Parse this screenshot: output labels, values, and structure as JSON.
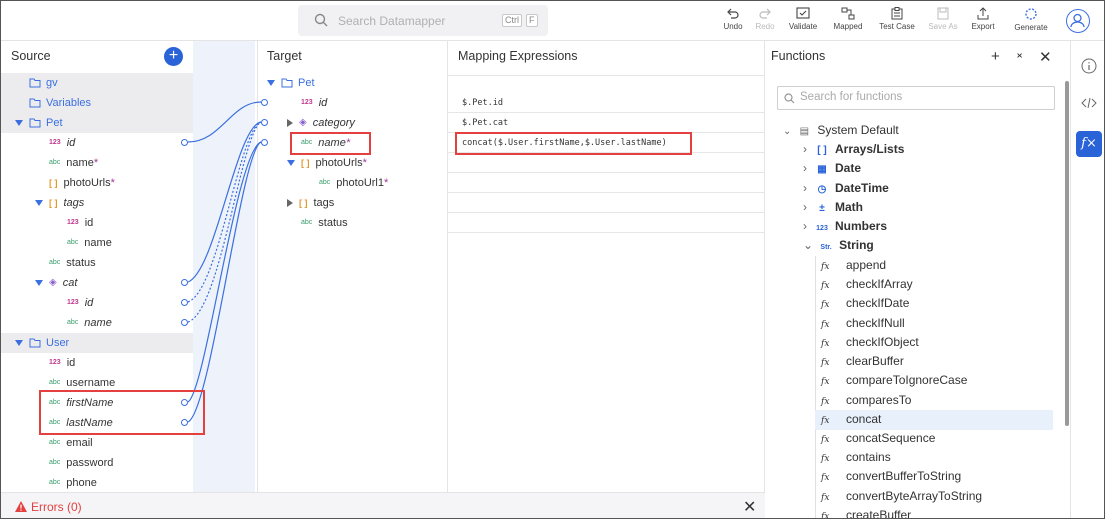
{
  "toolbar": {
    "search_placeholder": "Search Datamapper",
    "shortcut_key1": "Ctrl",
    "shortcut_key2": "F",
    "buttons": [
      {
        "label": "Undo",
        "enabled": true
      },
      {
        "label": "Redo",
        "enabled": false
      },
      {
        "label": "Validate",
        "enabled": true
      },
      {
        "label": "Mapped",
        "enabled": true
      },
      {
        "label": "Test Case",
        "enabled": true
      },
      {
        "label": "Save As",
        "enabled": false
      },
      {
        "label": "Export",
        "enabled": true
      },
      {
        "label": "Generate",
        "enabled": true
      }
    ]
  },
  "source": {
    "title": "Source",
    "items": [
      {
        "label": "gv",
        "type": "collection",
        "indent": 0
      },
      {
        "label": "Variables",
        "type": "collection",
        "indent": 0
      },
      {
        "label": "Pet",
        "type": "collection-open",
        "indent": 0
      },
      {
        "label": "id",
        "type": "number",
        "italic": true,
        "indent": 1
      },
      {
        "label": "name",
        "type": "string",
        "required": "*",
        "indent": 1
      },
      {
        "label": "photoUrls",
        "type": "array",
        "required": "*",
        "indent": 1
      },
      {
        "label": "tags",
        "type": "array-open",
        "italic": true,
        "indent": 1
      },
      {
        "label": "id",
        "type": "number",
        "indent": 2
      },
      {
        "label": "name",
        "type": "string",
        "indent": 2
      },
      {
        "label": "status",
        "type": "string",
        "indent": 1
      },
      {
        "label": "cat",
        "type": "object-open",
        "italic": true,
        "indent": 1
      },
      {
        "label": "id",
        "type": "number",
        "italic": true,
        "indent": 2
      },
      {
        "label": "name",
        "type": "string",
        "italic": true,
        "indent": 2
      },
      {
        "label": "User",
        "type": "collection-open",
        "indent": 0
      },
      {
        "label": "id",
        "type": "number",
        "indent": 1
      },
      {
        "label": "username",
        "type": "string",
        "indent": 1
      },
      {
        "label": "firstName",
        "type": "string",
        "italic": true,
        "indent": 1
      },
      {
        "label": "lastName",
        "type": "string",
        "italic": true,
        "indent": 1
      },
      {
        "label": "email",
        "type": "string",
        "indent": 1
      },
      {
        "label": "password",
        "type": "string",
        "indent": 1
      },
      {
        "label": "phone",
        "type": "string",
        "indent": 1
      }
    ]
  },
  "target": {
    "title": "Target",
    "items": [
      {
        "label": "Pet",
        "type": "collection-open",
        "indent": 0
      },
      {
        "label": "id",
        "type": "number",
        "italic": true,
        "indent": 1
      },
      {
        "label": "category",
        "type": "object-closed",
        "italic": true,
        "indent": 1
      },
      {
        "label": "name",
        "type": "string",
        "italic": true,
        "required": "*",
        "indent": 1
      },
      {
        "label": "photoUrls",
        "type": "array-open",
        "required": "*",
        "indent": 1
      },
      {
        "label": "photoUrl1",
        "type": "string",
        "required": "*",
        "indent": 2
      },
      {
        "label": "tags",
        "type": "array-closed",
        "indent": 1
      },
      {
        "label": "status",
        "type": "string",
        "indent": 1
      }
    ]
  },
  "mapping": {
    "title": "Mapping Expressions",
    "expressions": [
      "$.Pet.id",
      "$.Pet.cat",
      "concat($.User.firstName,$.User.lastName)",
      "",
      "",
      "",
      ""
    ]
  },
  "errors": {
    "label": "Errors (0)"
  },
  "functions": {
    "title": "Functions",
    "search_placeholder": "Search for functions",
    "root": "System Default",
    "categories": [
      {
        "label": "Arrays/Lists",
        "icon": "[ ]"
      },
      {
        "label": "Date",
        "icon": "▦"
      },
      {
        "label": "DateTime",
        "icon": "◷"
      },
      {
        "label": "Math",
        "icon": "±"
      },
      {
        "label": "Numbers",
        "icon": "123"
      },
      {
        "label": "String",
        "icon": "Str."
      }
    ],
    "string_functions": [
      "append",
      "checkIfArray",
      "checkIfDate",
      "checkIfNull",
      "checkIfObject",
      "clearBuffer",
      "compareToIgnoreCase",
      "comparesTo",
      "concat",
      "concatSequence",
      "contains",
      "convertBufferToString",
      "convertByteArrayToString",
      "createBuffer"
    ],
    "selected": "concat"
  },
  "colors": {
    "accent": "#2a63d8",
    "error": "#e44040",
    "connector": "#3b6fe0"
  }
}
